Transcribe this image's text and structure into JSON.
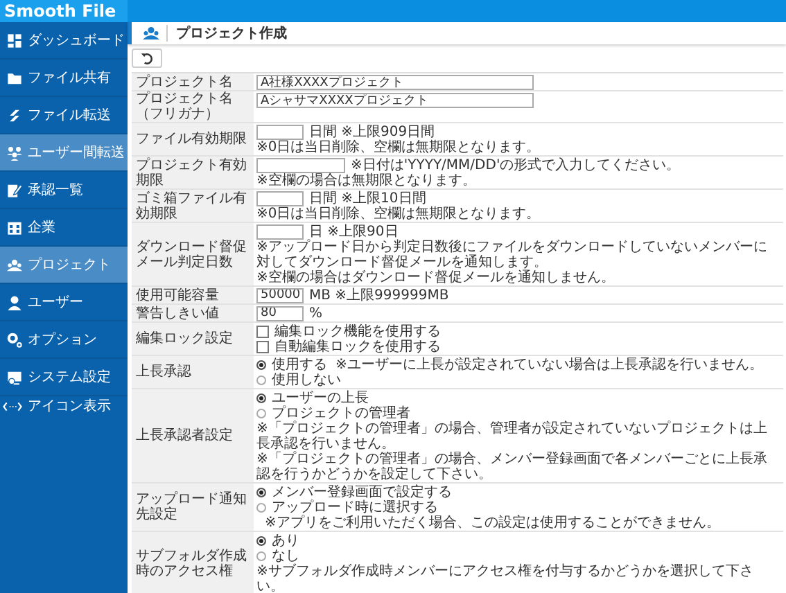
{
  "app": {
    "logo": "Smooth File"
  },
  "sidebar": {
    "items": [
      {
        "label": "ダッシュボード",
        "selected": false
      },
      {
        "label": "ファイル共有",
        "selected": false
      },
      {
        "label": "ファイル転送",
        "selected": false
      },
      {
        "label": "ユーザー間転送",
        "selected": true
      },
      {
        "label": "承認一覧",
        "selected": false
      },
      {
        "label": "企業",
        "selected": false
      },
      {
        "label": "プロジェクト",
        "selected": true
      },
      {
        "label": "ユーザー",
        "selected": false
      },
      {
        "label": "オプション",
        "selected": false
      },
      {
        "label": "システム設定",
        "selected": false
      },
      {
        "label": "アイコン表示",
        "selected": false
      }
    ]
  },
  "page": {
    "title": "プロジェクト作成"
  },
  "form": {
    "rows": [
      {
        "label": "プロジェクト名",
        "lines": [
          {
            "kind": "text",
            "value": "A社様XXXXプロジェクト"
          }
        ]
      },
      {
        "label": "プロジェクト名（フリガナ）",
        "lines": [
          {
            "kind": "text",
            "value": "AシャサマXXXXプロジェクト"
          }
        ]
      },
      {
        "label": "ファイル有効期限",
        "lines": [
          {
            "kind": "number",
            "suffix": "日間 ※上限909日間"
          },
          {
            "kind": "note",
            "text": "※0日は当日削除、空欄は無期限となります。"
          }
        ]
      },
      {
        "label": "プロジェクト有効期限",
        "lines": [
          {
            "kind": "date",
            "suffix": "※日付は'YYYY/MM/DD'の形式で入力してください。"
          },
          {
            "kind": "note",
            "text": "※空欄の場合は無期限となります。"
          }
        ]
      },
      {
        "label": "ゴミ箱ファイル有効期限",
        "lines": [
          {
            "kind": "number",
            "suffix": "日間 ※上限10日間"
          },
          {
            "kind": "note",
            "text": "※0日は当日削除、空欄は無期限となります。"
          }
        ]
      },
      {
        "label": "ダウンロード督促メール判定日数",
        "lines": [
          {
            "kind": "number",
            "suffix": "日 ※上限90日"
          },
          {
            "kind": "note",
            "text": "※アップロード日から判定日数後にファイルをダウンロードしていないメンバーに対してダウンロード督促メールを通知します。"
          },
          {
            "kind": "note",
            "text": "※空欄の場合はダウンロード督促メールを通知しません。"
          }
        ]
      },
      {
        "label": "使用可能容量",
        "lines": [
          {
            "kind": "number",
            "value": "50000",
            "suffix": "MB ※上限999999MB"
          }
        ]
      },
      {
        "label": "警告しきい値",
        "lines": [
          {
            "kind": "number",
            "value": "80",
            "suffix": "%"
          }
        ]
      },
      {
        "label": "編集ロック設定",
        "lines": [
          {
            "kind": "checkbox",
            "label": "編集ロック機能を使用する",
            "checked": false
          },
          {
            "kind": "checkbox",
            "label": "自動編集ロックを使用する",
            "checked": false
          }
        ]
      },
      {
        "label": "上長承認",
        "lines": [
          {
            "kind": "radio",
            "label": "使用する",
            "selected": true,
            "note": "※ユーザーに上長が設定されていない場合は上長承認を行いません。"
          },
          {
            "kind": "radio",
            "label": "使用しない",
            "selected": false
          }
        ]
      },
      {
        "label": "上長承認者設定",
        "lines": [
          {
            "kind": "radio",
            "label": "ユーザーの上長",
            "selected": true
          },
          {
            "kind": "radio",
            "label": "プロジェクトの管理者",
            "selected": false
          },
          {
            "kind": "note",
            "text": "※「プロジェクトの管理者」の場合、管理者が設定されていないプロジェクトは上長承認を行いません。"
          },
          {
            "kind": "note",
            "text": "※「プロジェクトの管理者」の場合、メンバー登録画面で各メンバーごとに上長承認を行うかどうかを設定して下さい。"
          }
        ]
      },
      {
        "label": "アップロード通知先設定",
        "lines": [
          {
            "kind": "radio",
            "label": "メンバー登録画面で設定する",
            "selected": true
          },
          {
            "kind": "radio",
            "label": "アップロード時に選択する",
            "selected": false,
            "note": "※アプリをご利用いただく場合、この設定は使用することができません。"
          }
        ]
      },
      {
        "label": "サブフォルダ作成時のアクセス権",
        "lines": [
          {
            "kind": "radio",
            "label": "あり",
            "selected": true
          },
          {
            "kind": "radio",
            "label": "なし",
            "selected": false
          },
          {
            "kind": "note",
            "text": "※サブフォルダ作成時メンバーにアクセス権を付与するかどうかを選択して下さい。"
          }
        ]
      }
    ]
  }
}
